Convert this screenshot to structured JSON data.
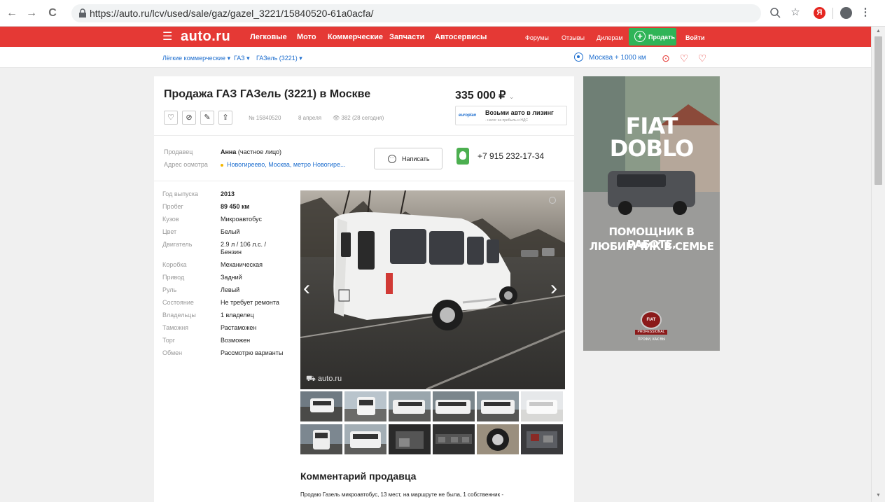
{
  "browser": {
    "url": "https://auto.ru/lcv/used/sale/gaz/gazel_3221/15840520-61a0acfa/",
    "back_icon": "←",
    "forward_icon": "→",
    "reload_icon": "C",
    "yandex_label": "Я"
  },
  "header": {
    "logo": "auto.ru",
    "nav": [
      "Легковые",
      "Мото",
      "Коммерческие",
      "Запчасти",
      "Автосервисы"
    ],
    "right_nav": [
      "Форумы",
      "Отзывы",
      "Дилерам"
    ],
    "sell_label": "Продать",
    "login_label": "Войти",
    "brand_color": "#e53935",
    "sell_color": "#2fb457"
  },
  "breadcrumbs": {
    "items": [
      "Лёгкие коммерческие",
      "ГАЗ",
      "ГАЗель (3221)"
    ],
    "region": "Москва + 1000 км"
  },
  "listing": {
    "title": "Продажа ГАЗ ГАЗель (3221) в Москве",
    "price": "335 000 ₽",
    "id": "№ 15840520",
    "date": "8 апреля",
    "views": "382 (28 сегодня)",
    "leasing": {
      "brand": "europlan",
      "title": "Возьми авто в лизинг",
      "subtitle": "- налог на прибыль и НДС"
    }
  },
  "seller": {
    "seller_label": "Продавец",
    "name": "Анна",
    "type": "(частное лицо)",
    "address_label": "Адрес осмотра",
    "address": "Новогиреево, Москва, метро Новогире...",
    "write_label": "Написать",
    "phone": "+7 915 232-17-34"
  },
  "specs": [
    {
      "key": "Год выпуска",
      "value": "2013"
    },
    {
      "key": "Пробег",
      "value": "89 450 км"
    },
    {
      "key": "Кузов",
      "value": "Микроавтобус"
    },
    {
      "key": "Цвет",
      "value": "Белый"
    },
    {
      "key": "Двигатель",
      "value": "2.9 л / 106 л.с. /",
      "value2": "Бензин"
    },
    {
      "key": "Коробка",
      "value": "Механическая"
    },
    {
      "key": "Привод",
      "value": "Задний"
    },
    {
      "key": "Руль",
      "value": "Левый"
    },
    {
      "key": "Состояние",
      "value": "Не требует ремонта"
    },
    {
      "key": "Владельцы",
      "value": "1 владелец"
    },
    {
      "key": "Таможня",
      "value": "Растаможен"
    },
    {
      "key": "Торг",
      "value": "Возможен"
    },
    {
      "key": "Обмен",
      "value": "Рассмотрю варианты"
    }
  ],
  "photo": {
    "watermark": "auto.ru"
  },
  "comment": {
    "heading": "Комментарий продавца",
    "text": "Продаю Газель микроавтобус, 13 мест, на маршруте не была, 1 собственник -"
  },
  "ad": {
    "headline": "FIAT DOBLO",
    "subline1": "ПОМОЩНИК В РАБОТЕ,",
    "subline2": "ЛЮБИМЧИК В СЕМЬЕ",
    "badge": "FIAT",
    "pro": "PROFESSIONAL",
    "slogan": "ПРОФИ, КАК ВЫ"
  }
}
